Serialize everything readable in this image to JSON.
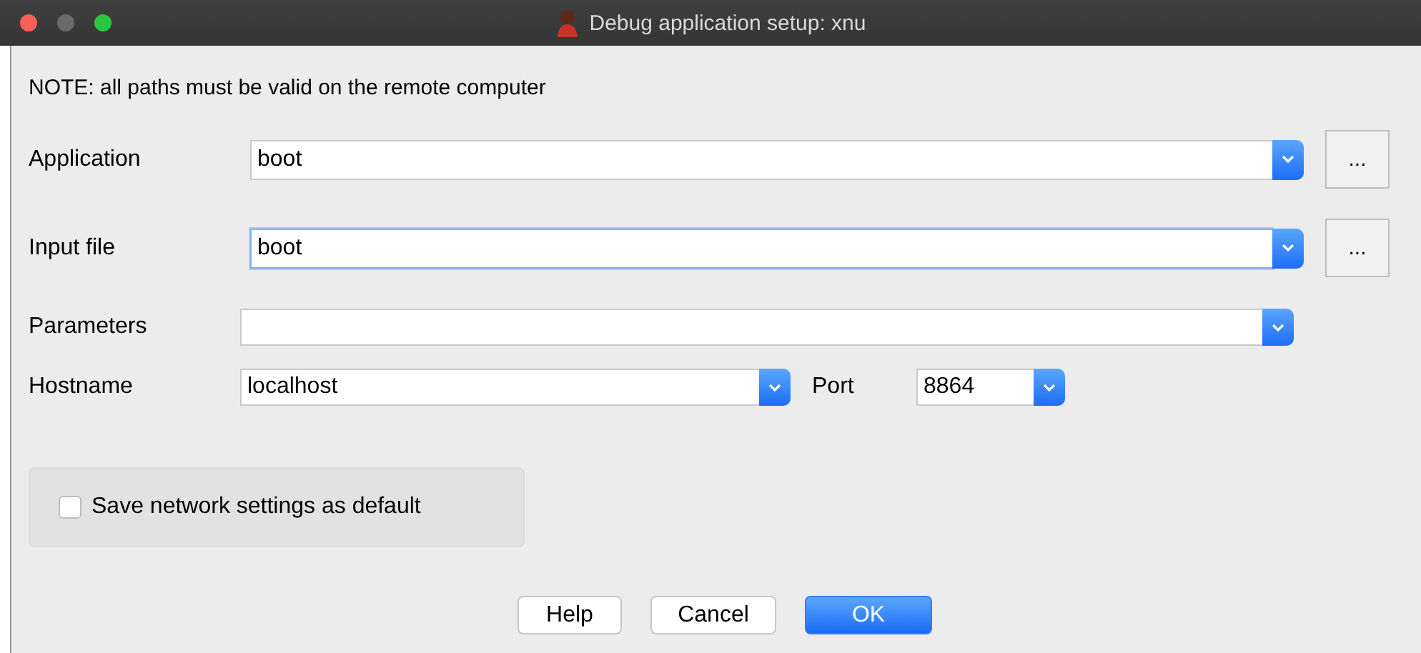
{
  "window": {
    "title": "Debug application setup: xnu"
  },
  "note": "NOTE: all paths must be valid on the remote computer",
  "fields": [
    {
      "kind": "browse",
      "label": "Application",
      "value": "boot",
      "focused": false,
      "button": "..."
    },
    {
      "kind": "browse",
      "label": "Input file",
      "value": "boot",
      "focused": true,
      "button": "..."
    },
    {
      "kind": "plain",
      "label": "Parameters",
      "focused": false
    }
  ],
  "host_row": {
    "hostname_label": "Hostname",
    "hostname": "localhost",
    "port_label": "Port",
    "port": "8864"
  },
  "save_default": {
    "label": "Save network settings as default",
    "checked": false
  },
  "buttons": [
    {
      "label": "Help",
      "default": false
    },
    {
      "label": "Cancel",
      "default": false
    },
    {
      "label": "OK",
      "default": true
    }
  ]
}
